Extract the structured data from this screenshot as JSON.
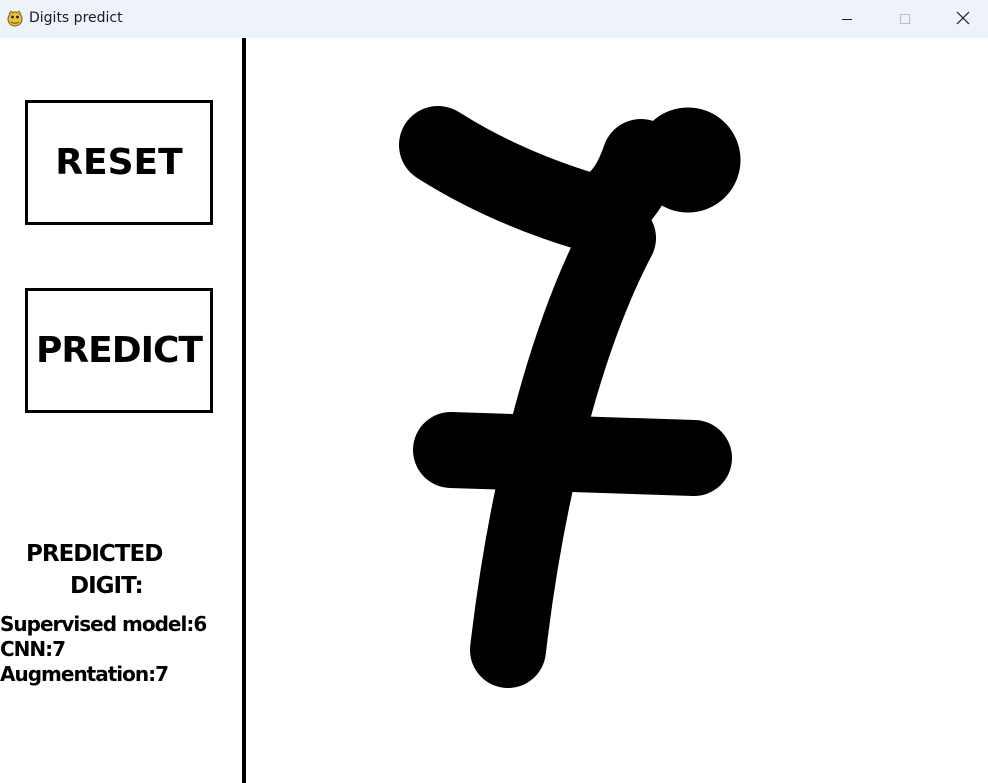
{
  "window": {
    "title": "Digits predict",
    "app_icon": "pygame-snake-icon",
    "controls": [
      "minimize-icon",
      "maximize-icon",
      "close-icon"
    ]
  },
  "sidebar": {
    "reset_label": "RESET",
    "predict_label": "PREDICT",
    "predicted_heading_line1": "PREDICTED",
    "predicted_heading_line2": "DIGIT:",
    "results": [
      "Supervised model:6",
      "CNN:7",
      "Augmentation:7"
    ]
  },
  "canvas": {
    "background": "#ffffff",
    "stroke_color": "#000000"
  },
  "colors": {
    "titlebar": "#eef2f9",
    "divider": "#000000",
    "text": "#000000"
  }
}
